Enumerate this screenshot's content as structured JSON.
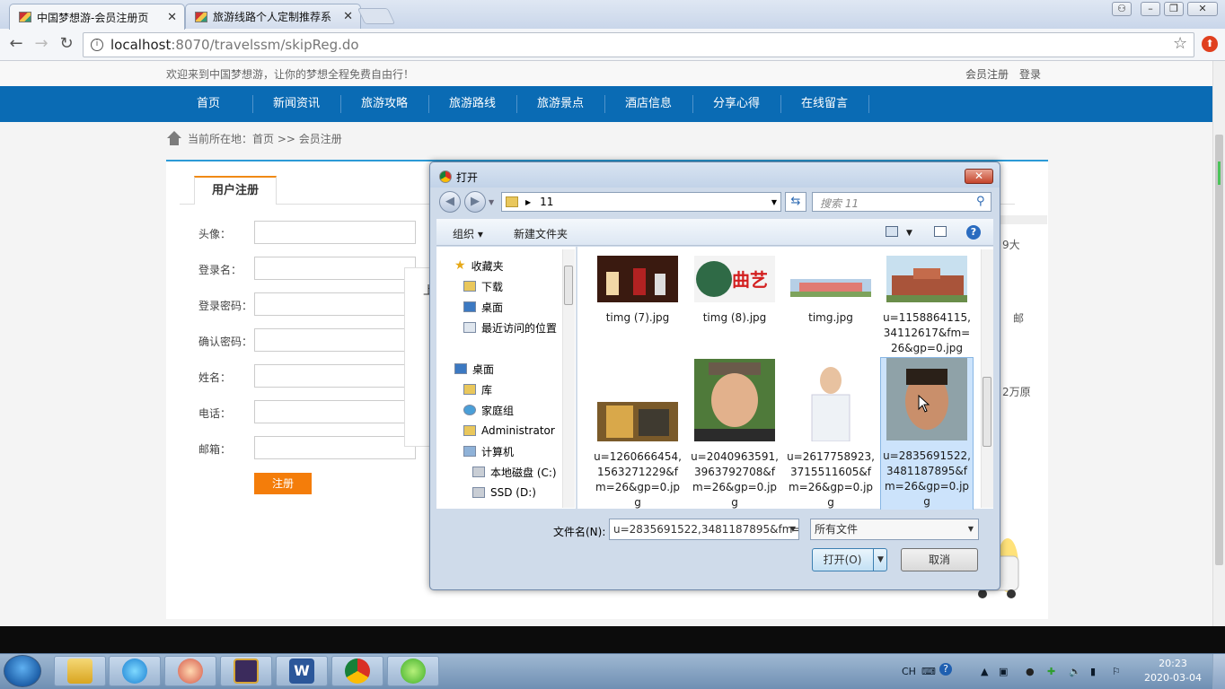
{
  "browser": {
    "tabs": [
      {
        "title": "中国梦想游-会员注册页",
        "active": true
      },
      {
        "title": "旅游线路个人定制推荐系",
        "active": false
      }
    ],
    "url_host": "localhost",
    "url_path": ":8070/travelssm/skipReg.do"
  },
  "site": {
    "welcome": "欢迎来到中国梦想游，让你的梦想全程免费自由行！",
    "top_links": [
      "会员注册",
      "登录"
    ],
    "nav": [
      "首页",
      "新闻资讯",
      "旅游攻略",
      "旅游路线",
      "旅游景点",
      "酒店信息",
      "分享心得",
      "在线留言"
    ],
    "breadcrumb": "当前所在地：首页 >> 会员注册",
    "reg_tab": "用户注册",
    "fields": [
      "头像：",
      "登录名：",
      "登录密码：",
      "确认密码：",
      "姓名：",
      "电话：",
      "邮箱："
    ],
    "submit": "注册",
    "upload_partial": "上",
    "side_texts": [
      "9大",
      "邮",
      "2万原"
    ]
  },
  "dialog": {
    "title": "打开",
    "address_folder": "11",
    "search_placeholder": "搜索 11",
    "organize": "组织",
    "new_folder": "新建文件夹",
    "nav_items": [
      {
        "label": "收藏夹",
        "icon": "star-icon"
      },
      {
        "label": "下载",
        "icon": "download-folder-icon"
      },
      {
        "label": "桌面",
        "icon": "desktop-icon"
      },
      {
        "label": "最近访问的位置",
        "icon": "recent-places-icon"
      },
      {
        "label": "桌面",
        "icon": "desktop-icon"
      },
      {
        "label": "库",
        "icon": "library-icon"
      },
      {
        "label": "家庭组",
        "icon": "homegroup-icon"
      },
      {
        "label": "Administrator",
        "icon": "user-folder-icon"
      },
      {
        "label": "计算机",
        "icon": "computer-icon"
      },
      {
        "label": "本地磁盘 (C:)",
        "icon": "drive-icon"
      },
      {
        "label": "SSD (D:)",
        "icon": "drive-icon"
      }
    ],
    "files_row1": [
      "timg (7).jpg",
      "timg (8).jpg",
      "timg.jpg",
      "u=1158864115,34112617&fm=26&gp=0.jpg"
    ],
    "files_row2": [
      "u=1260666454,1563271229&fm=26&gp=0.jpg",
      "u=2040963591,3963792708&fm=26&gp=0.jpg",
      "u=2617758923,3715511605&fm=26&gp=0.jpg",
      "u=2835691522,3481187895&fm=26&gp=0.jpg"
    ],
    "thumb8_text": "曲艺",
    "filename_label": "文件名(N):",
    "filename_value": "u=2835691522,3481187895&fm=",
    "filter": "所有文件",
    "open_btn": "打开(O)",
    "cancel_btn": "取消"
  },
  "taskbar": {
    "lang": "CH",
    "time": "20:23",
    "date": "2020-03-04",
    "apps": [
      "file-explorer",
      "ie-browser",
      "qq-avatar",
      "java-ee-ide",
      "word",
      "chrome",
      "sync-app"
    ]
  }
}
